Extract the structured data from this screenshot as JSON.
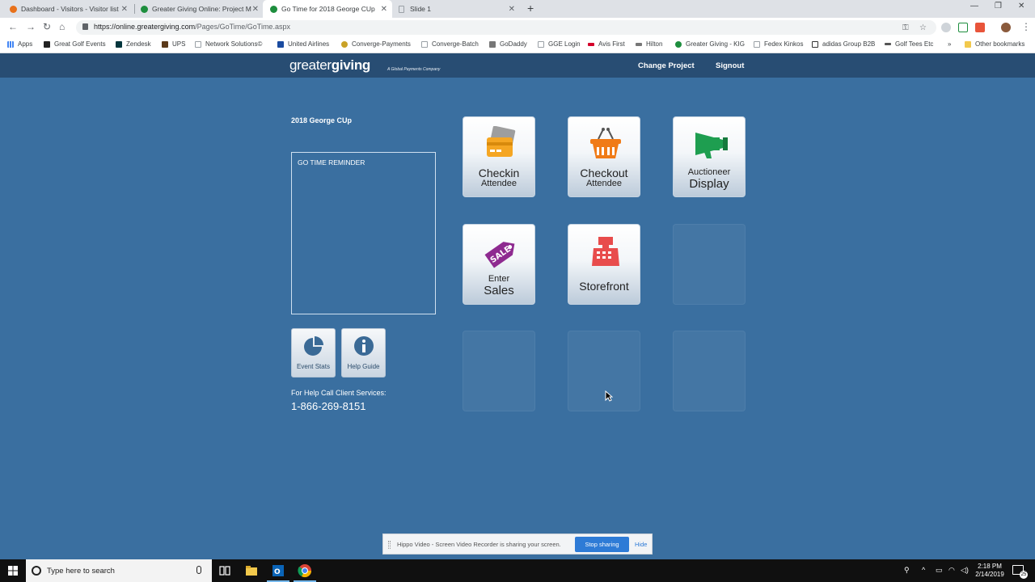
{
  "browser": {
    "tabs": [
      {
        "title": "Dashboard - Visitors - Visitor list",
        "fav_color": "#e8711a",
        "active": false
      },
      {
        "title": "Greater Giving Online: Project M",
        "fav_color": "#1e8e3e",
        "active": false
      },
      {
        "title": "Go Time for 2018 George CUp",
        "fav_color": "#1e8e3e",
        "active": true
      },
      {
        "title": "Slide 1",
        "fav_color": "#9aa0a6",
        "active": false
      }
    ],
    "url_host": "https://online.greatergiving.com",
    "url_path": "/Pages/GoTime/GoTime.aspx",
    "bookmarks": [
      {
        "label": "Apps",
        "color": "#4285f4"
      },
      {
        "label": "Great Golf Events",
        "color": "#222222"
      },
      {
        "label": "Zendesk",
        "color": "#03363d"
      },
      {
        "label": "UPS",
        "color": "#5b3a1a"
      },
      {
        "label": "Network Solutions©",
        "color": "#9aa0a6"
      },
      {
        "label": "United Airlines",
        "color": "#1a4ba0"
      },
      {
        "label": "Converge-Payments",
        "color": "#c9a227"
      },
      {
        "label": "Converge-Batch",
        "color": "#9aa0a6"
      },
      {
        "label": "GoDaddy",
        "color": "#777777"
      },
      {
        "label": "GGE Login",
        "color": "#9aa0a6"
      },
      {
        "label": "Avis First",
        "color": "#d4002a"
      },
      {
        "label": "Hilton",
        "color": "#777777"
      },
      {
        "label": "Greater Giving - KIG",
        "color": "#1e8e3e"
      },
      {
        "label": "Fedex Kinkos",
        "color": "#9aa0a6"
      },
      {
        "label": "adidas Group B2B",
        "color": "#333333"
      },
      {
        "label": "Golf Tees Etc",
        "color": "#555555"
      },
      {
        "label": "Other bookmarks",
        "color": "#f2c94c"
      }
    ]
  },
  "header": {
    "logo_light": "greater",
    "logo_bold": "giving",
    "logo_sub": "A Global Payments Company",
    "change_project": "Change Project",
    "signout": "Signout"
  },
  "main": {
    "project_title": "2018 George CUp",
    "reminder_title": "GO TIME REMINDER",
    "event_stats": "Event Stats",
    "help_guide": "Help Guide",
    "help_call": "For Help Call Client Services:",
    "phone": "1-866-269-8151",
    "tiles": {
      "checkin": {
        "line1": "Checkin",
        "line2": "Attendee"
      },
      "checkout": {
        "line1": "Checkout",
        "line2": "Attendee"
      },
      "auctioneer": {
        "line1": "Auctioneer",
        "line2": "Display"
      },
      "sales": {
        "line1": "Enter",
        "line2": "Sales",
        "tag": "SALE"
      },
      "storefront": {
        "line1": "Storefront"
      }
    }
  },
  "share_banner": {
    "text": "Hippo Video - Screen Video Recorder is sharing your screen.",
    "stop": "Stop sharing",
    "hide": "Hide"
  },
  "taskbar": {
    "search_placeholder": "Type here to search",
    "time": "2:18 PM",
    "date": "2/14/2019",
    "notifications": "25"
  }
}
